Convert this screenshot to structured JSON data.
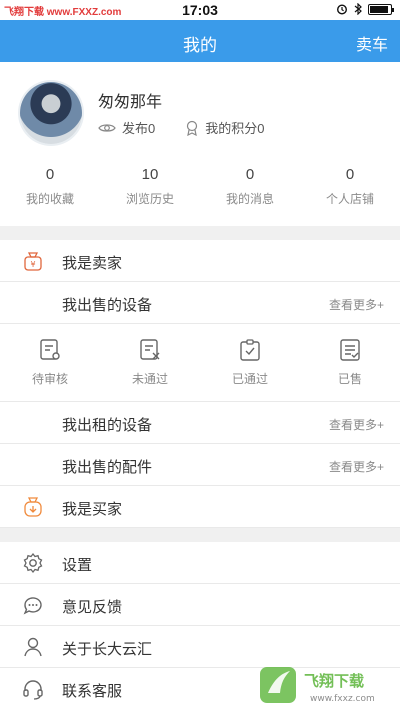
{
  "status_bar": {
    "watermark": "飞翔下载 www.FXXZ.com",
    "time": "17:03"
  },
  "nav": {
    "title": "我的",
    "sell_button": "卖车"
  },
  "profile": {
    "username": "匆匆那年",
    "published": "发布0",
    "points": "我的积分0"
  },
  "stats": [
    {
      "num": "0",
      "label": "我的收藏"
    },
    {
      "num": "10",
      "label": "浏览历史"
    },
    {
      "num": "0",
      "label": "我的消息"
    },
    {
      "num": "0",
      "label": "个人店铺"
    }
  ],
  "seller": {
    "title": "我是卖家",
    "selling_devices": "我出售的设备",
    "more": "查看更多+",
    "statuses": [
      "待审核",
      "未通过",
      "已通过",
      "已售"
    ],
    "rental_devices": "我出租的设备",
    "selling_parts": "我出售的配件"
  },
  "buyer": {
    "title": "我是买家"
  },
  "menu": {
    "settings": "设置",
    "feedback": "意见反馈",
    "about": "关于长大云汇",
    "contact": "联系客服"
  },
  "watermark_bottom": {
    "brand": "飞翔下载",
    "url": "www.fxxz.com"
  },
  "colors": {
    "accent": "#3a9bea",
    "icon_orange": "#f08a3c",
    "separator": "#f0f0f0"
  }
}
